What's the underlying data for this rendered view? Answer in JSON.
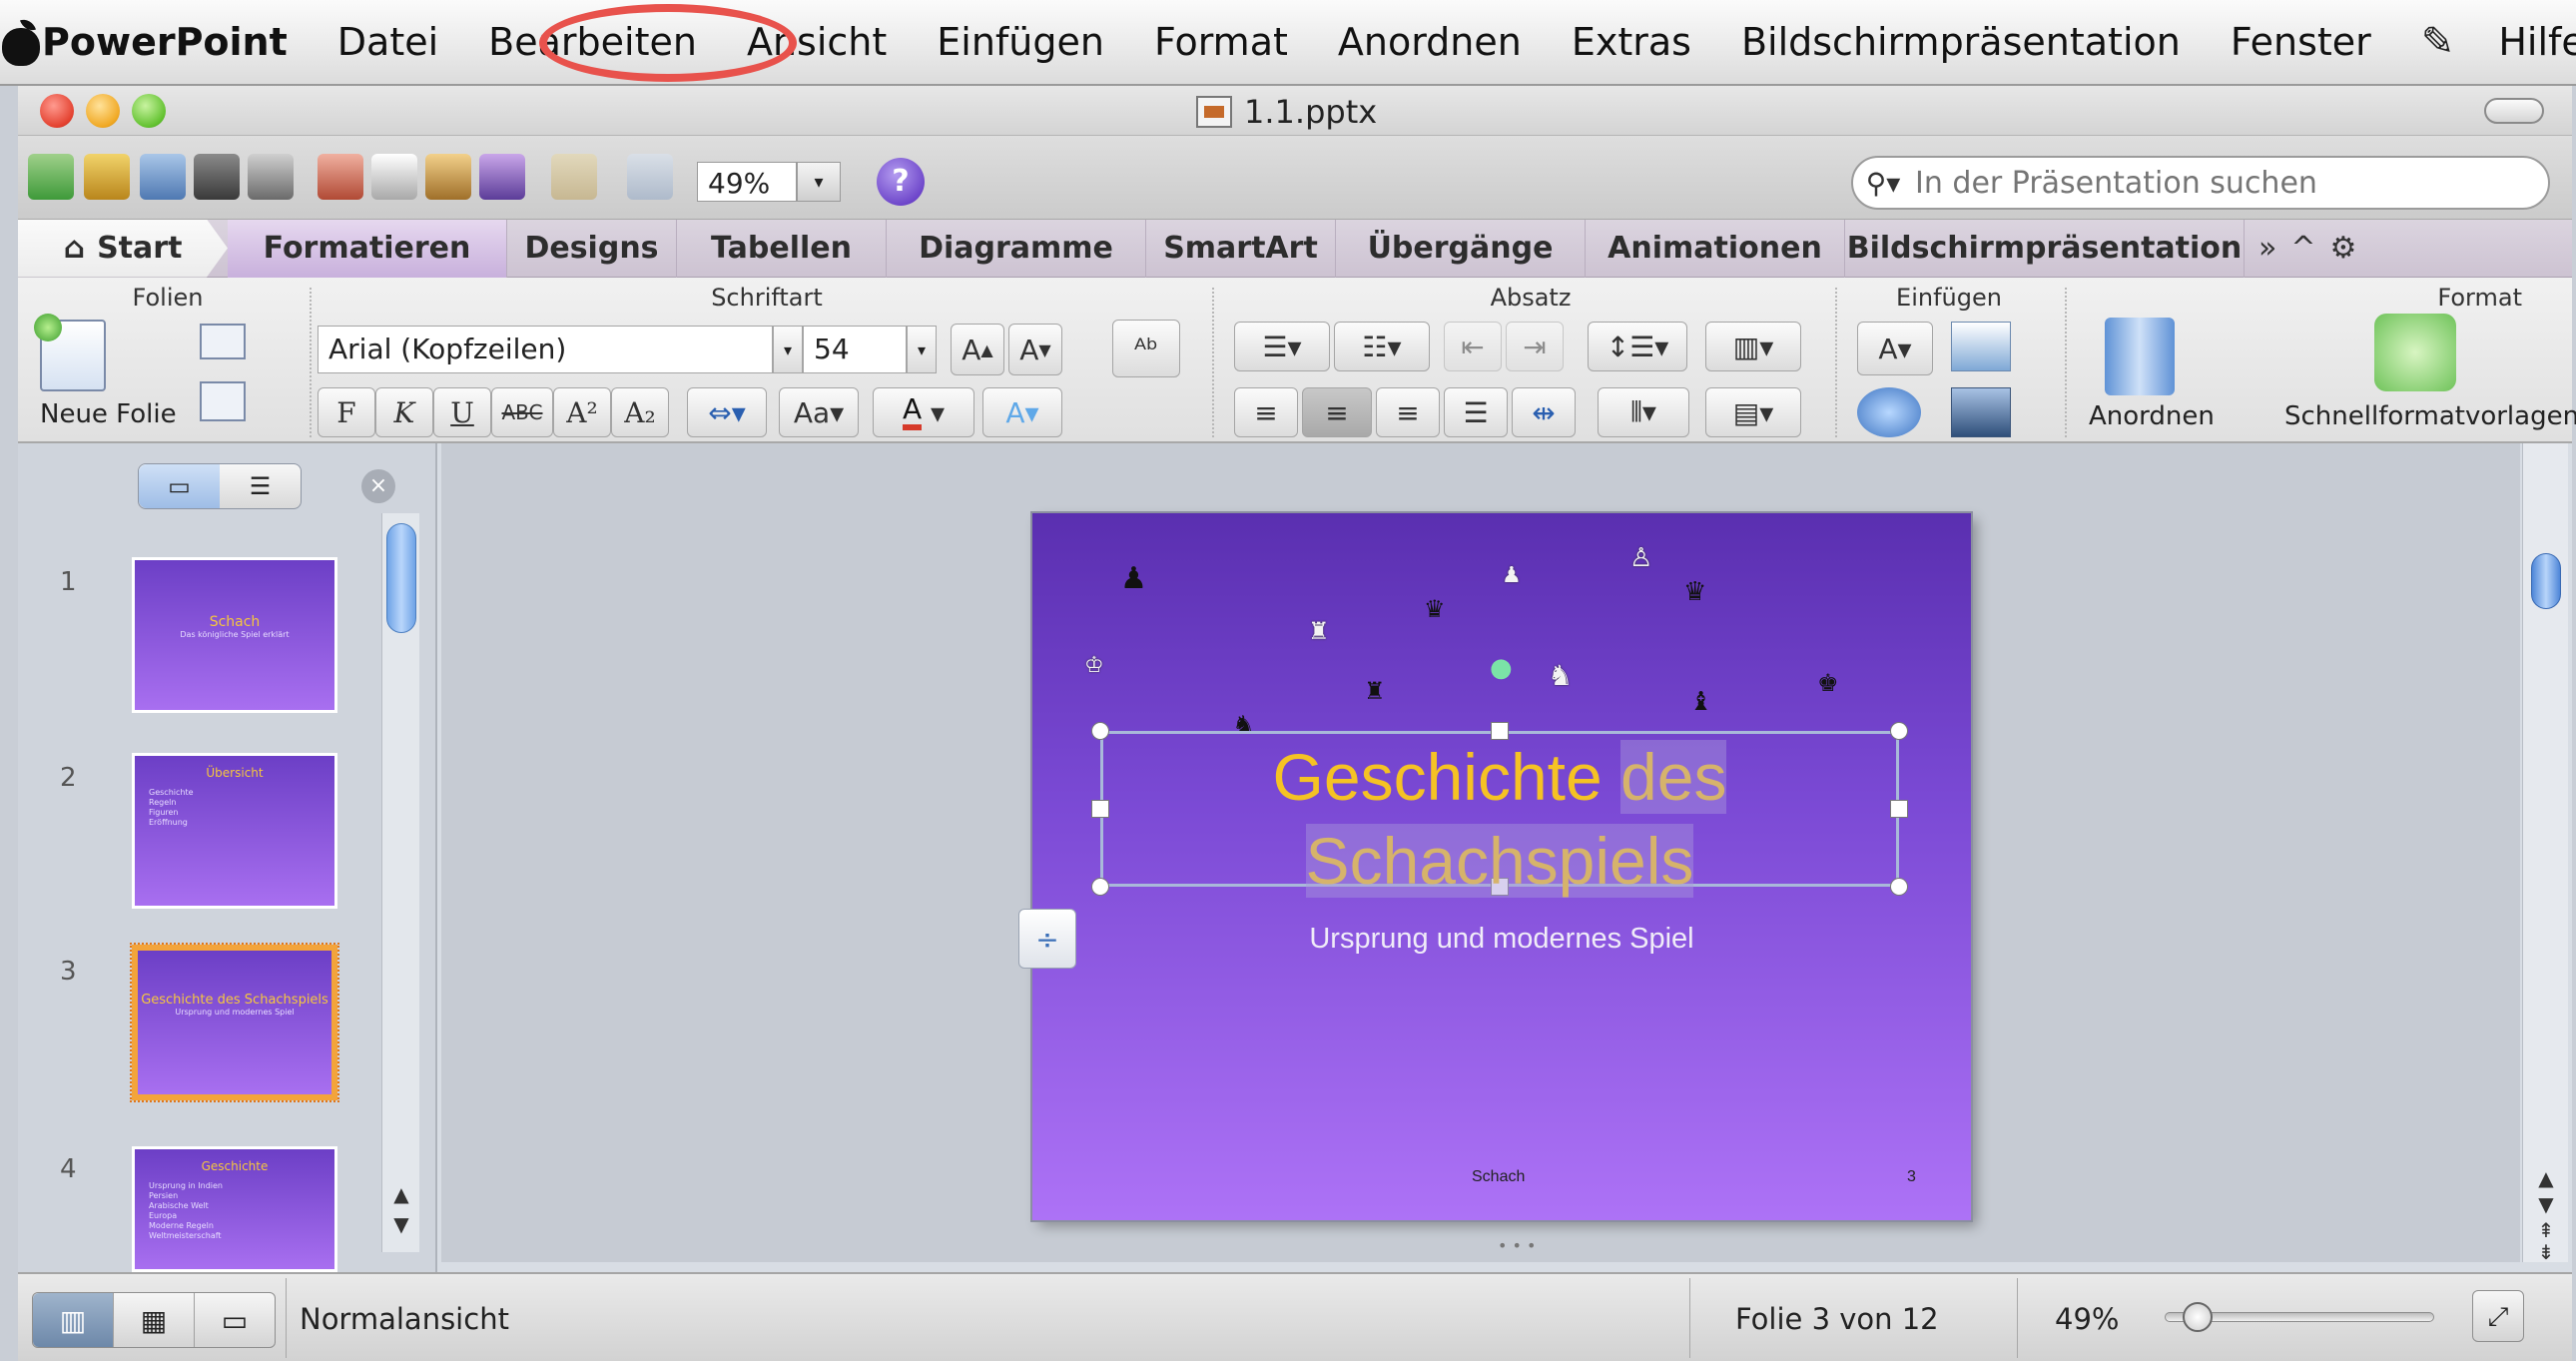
{
  "menubar": {
    "app_name": "PowerPoint",
    "items": [
      "Datei",
      "Bearbeiten",
      "Ansicht",
      "Einfügen",
      "Format",
      "Anordnen",
      "Extras",
      "Bildschirmpräsentation",
      "Fenster",
      "Hilfe"
    ],
    "highlighted_item": "Bearbeiten",
    "highlight_color": "#e8524c"
  },
  "window": {
    "title": "1.1.pptx"
  },
  "toolbar": {
    "zoom": "49%",
    "help": "?",
    "search": {
      "placeholder": "In der Präsentation suchen"
    }
  },
  "ribbon_tabs": {
    "start": "Start",
    "tabs": [
      "Formatieren",
      "Designs",
      "Tabellen",
      "Diagramme",
      "SmartArt",
      "Übergänge",
      "Animationen",
      "Bildschirmpräsentation"
    ],
    "active": "Formatieren",
    "more": "»",
    "collapse": "^",
    "settings": "⚙"
  },
  "ribbon": {
    "groups": {
      "folien": "Folien",
      "schriftart": "Schriftart",
      "absatz": "Absatz",
      "einfuegen": "Einfügen",
      "format": "Format"
    },
    "neue_folie": "Neue Folie",
    "font_name": "Arial (Kopfzeilen)",
    "font_size": "54",
    "bold": "F",
    "italic": "K",
    "underline": "U",
    "strike": "ABC",
    "superscript": "A²",
    "subscript": "A₂",
    "grow": "A",
    "shrink": "A",
    "font_color": "A",
    "anordnen": "Anordnen",
    "schnellformat": "Schnellformatvorlagen"
  },
  "slides_panel": {
    "slides": [
      {
        "number": "1",
        "title": "Schach",
        "subtitle": "Das königliche Spiel erklärt"
      },
      {
        "number": "2",
        "title": "Übersicht",
        "items": [
          "Geschichte",
          "Regeln",
          "Figuren",
          "Eröffnung"
        ]
      },
      {
        "number": "3",
        "title": "Geschichte des Schachspiels",
        "subtitle": "Ursprung und modernes Spiel"
      },
      {
        "number": "4",
        "title": "Geschichte",
        "items": [
          "Ursprung in Indien",
          "Persien",
          "Arabische Welt",
          "Europa",
          "Moderne Regeln",
          "Weltmeisterschaft"
        ]
      }
    ],
    "selected": "3"
  },
  "slide": {
    "title_part1": "Geschichte",
    "title_part2": "des",
    "title_part3": "Schachspiels",
    "subtitle": "Ursprung und modernes Spiel",
    "footer": "Schach",
    "page_number": "3",
    "colors": {
      "title": "#f5c224",
      "background_top": "#5a2fb0",
      "background_bottom": "#ad72f6"
    }
  },
  "statusbar": {
    "view_label": "Normalansicht",
    "slide_info": "Folie 3 von 12",
    "zoom": "49%",
    "zoom_level_fraction": 0.1
  }
}
